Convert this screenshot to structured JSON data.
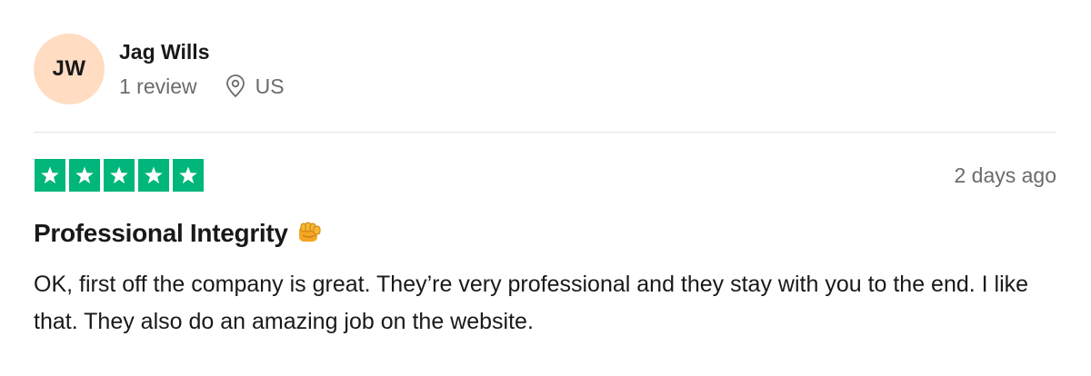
{
  "reviewer": {
    "initials": "JW",
    "name": "Jag Wills",
    "review_count": "1 review",
    "location": "US",
    "avatar_color": "#ffdcc2"
  },
  "rating": {
    "stars": 5,
    "max_stars": 5,
    "star_color": "#00b67a"
  },
  "date": "2 days ago",
  "review": {
    "title": "Professional Integrity",
    "title_icon": "oncoming-fist-icon",
    "body": "OK, first off the company is great. They’re very professional and they stay with you to the end. I like that. They also do an amazing job on the website."
  },
  "icons": {
    "location": "location-pin-icon",
    "star": "star-icon"
  }
}
